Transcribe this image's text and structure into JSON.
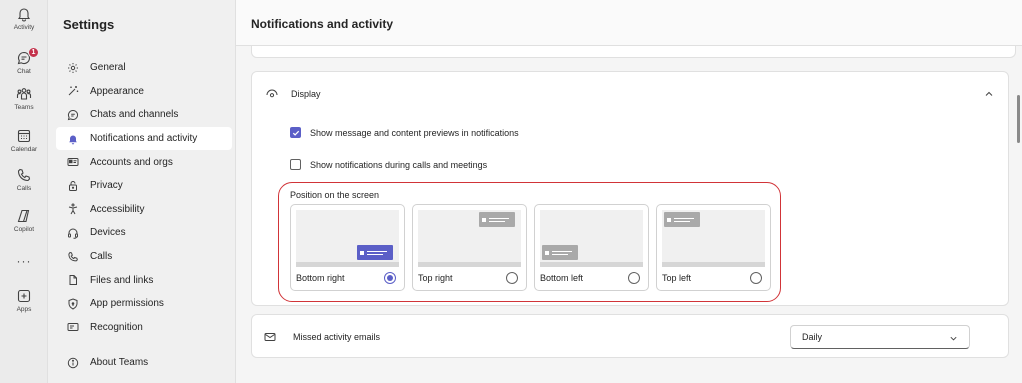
{
  "rail": {
    "items": [
      {
        "label": "Activity",
        "icon": "bell-icon"
      },
      {
        "label": "Chat",
        "icon": "chat-icon",
        "badge": "1"
      },
      {
        "label": "Teams",
        "icon": "teams-icon"
      },
      {
        "label": "Calendar",
        "icon": "calendar-icon"
      },
      {
        "label": "Calls",
        "icon": "phone-icon"
      },
      {
        "label": "Copilot",
        "icon": "copilot-icon"
      },
      {
        "label": "Apps",
        "icon": "add-apps-icon"
      }
    ],
    "more": "···"
  },
  "sidebar": {
    "title": "Settings",
    "items": [
      {
        "label": "General",
        "icon": "gear-icon"
      },
      {
        "label": "Appearance",
        "icon": "magic-wand-icon"
      },
      {
        "label": "Chats and channels",
        "icon": "chat-bubble-icon"
      },
      {
        "label": "Notifications and activity",
        "icon": "bell-filled-icon",
        "active": true
      },
      {
        "label": "Accounts and orgs",
        "icon": "contact-card-icon"
      },
      {
        "label": "Privacy",
        "icon": "lock-icon"
      },
      {
        "label": "Accessibility",
        "icon": "accessibility-icon"
      },
      {
        "label": "Devices",
        "icon": "headset-icon"
      },
      {
        "label": "Calls",
        "icon": "phone-icon"
      },
      {
        "label": "Files and links",
        "icon": "document-icon"
      },
      {
        "label": "App permissions",
        "icon": "shield-icon"
      },
      {
        "label": "Recognition",
        "icon": "id-card-icon"
      }
    ],
    "about": {
      "label": "About Teams",
      "icon": "info-icon"
    }
  },
  "main": {
    "title": "Notifications and activity",
    "display": {
      "label": "Display",
      "options": [
        {
          "label": "Show message and content previews in notifications",
          "checked": true
        },
        {
          "label": "Show notifications during calls and meetings",
          "checked": false
        }
      ],
      "position": {
        "label": "Position on the screen",
        "tiles": [
          {
            "label": "Bottom right",
            "selected": true
          },
          {
            "label": "Top right",
            "selected": false
          },
          {
            "label": "Bottom left",
            "selected": false
          },
          {
            "label": "Top left",
            "selected": false
          }
        ]
      }
    },
    "missed": {
      "label": "Missed activity emails",
      "value": "Daily"
    }
  },
  "colors": {
    "accent": "#5b5fc7",
    "highlight_outline": "#d13438",
    "badge": "#c4314b"
  }
}
